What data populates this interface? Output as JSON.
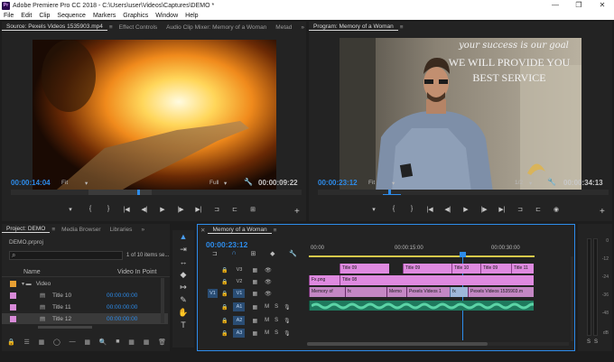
{
  "titlebar": {
    "logo": "Pr",
    "text": "Adobe Premiere Pro CC 2018 - C:\\Users\\user\\Videos\\Captures\\DEMO *",
    "minimize": "—",
    "restore": "❐",
    "close": "✕"
  },
  "menu": [
    "File",
    "Edit",
    "Clip",
    "Sequence",
    "Markers",
    "Graphics",
    "Window",
    "Help"
  ],
  "source": {
    "tabs": [
      "Source: Pexels Videos 1535903.mp4",
      "Effect Controls",
      "Audio Clip Mixer: Memory of a Woman",
      "Metad"
    ],
    "menu_icon": "≡",
    "more": "»",
    "timecode": "00:00:14:04",
    "fit": "Fit",
    "resolution": "Full",
    "duration": "00:00:09:22"
  },
  "program": {
    "tab": "Program: Memory of a Woman",
    "menu_icon": "≡",
    "timecode": "00:00:23:12",
    "fit": "Fit",
    "resolution": "1/2",
    "duration": "00:00:34:13",
    "overlay_line1": "your success is our goal",
    "overlay_line2": "WE WILL PROVIDE YOU",
    "overlay_line3": "BEST SERVICE"
  },
  "transport": [
    "▾",
    "{",
    "}",
    "|◀",
    "◀|",
    "▶",
    "|▶",
    "▶|",
    "⊐",
    "⊏",
    "⊞",
    "◉"
  ],
  "project": {
    "tabs": [
      "Project: DEMO",
      "Media Browser",
      "Libraries"
    ],
    "menu_icon": "≡",
    "more": "»",
    "file": "DEMO.prproj",
    "items_count": "1 of 10 items se...",
    "search_icon_glyph": "⌕",
    "col_name": "Name",
    "col_inpoint": "Video In Point",
    "rows": [
      {
        "name": "Video",
        "inpoint": "",
        "color": "#e8a033",
        "type": "folder",
        "icon": "▾ ▬"
      },
      {
        "name": "Title 10",
        "inpoint": "00:00:00:00",
        "color": "#d88ad8",
        "type": "title",
        "icon": "▤"
      },
      {
        "name": "Title 11",
        "inpoint": "00:00:00:00",
        "color": "#d88ad8",
        "type": "title",
        "icon": "▤"
      },
      {
        "name": "Title 12",
        "inpoint": "00:00:00:00",
        "color": "#d88ad8",
        "type": "title",
        "icon": "▤"
      }
    ],
    "bottom_icons": [
      "🔒",
      "☰",
      "▦",
      "◯",
      "—",
      "▦",
      "🔍",
      "■",
      "▦",
      "▦",
      "🗑"
    ]
  },
  "tools": [
    "▲",
    "⇥",
    "↔",
    "◆",
    "↦",
    "✎",
    "✋",
    "T"
  ],
  "timeline": {
    "close": "✕",
    "tab": "Memory of a Woman",
    "menu_icon": "≡",
    "timecode": "00:00:23:12",
    "ruler": [
      "00:00",
      "00:00:15:00",
      "00:00:30:00"
    ],
    "header_icons": [
      "⊐",
      "∩",
      "⊞",
      "◆",
      "🔧"
    ],
    "tracks": [
      {
        "src": "",
        "name": "V3",
        "lock": "🔒",
        "sync": "▦",
        "eye": "👁",
        "m": "",
        "s": "",
        "mic": ""
      },
      {
        "src": "",
        "name": "V2",
        "lock": "🔒",
        "sync": "▦",
        "eye": "👁",
        "m": "",
        "s": "",
        "mic": ""
      },
      {
        "src": "V1",
        "name": "V1",
        "lock": "🔒",
        "sync": "▦",
        "eye": "👁",
        "m": "",
        "s": "",
        "mic": ""
      },
      {
        "src": "",
        "name": "A1",
        "lock": "🔒",
        "sync": "▦",
        "eye": "",
        "m": "M",
        "s": "S",
        "mic": "🎙"
      },
      {
        "src": "",
        "name": "A2",
        "lock": "🔒",
        "sync": "▦",
        "eye": "",
        "m": "M",
        "s": "S",
        "mic": "🎙"
      },
      {
        "src": "",
        "name": "A3",
        "lock": "🔒",
        "sync": "▦",
        "eye": "",
        "m": "M",
        "s": "S",
        "mic": "🎙"
      }
    ],
    "clips_v3": [
      "Title 09",
      "Title 09",
      "Title 10",
      "Title 09",
      "Title 11"
    ],
    "clips_v2": [
      "Fx.png",
      "Title 08"
    ],
    "clips_v1": [
      "Memory of",
      "fx",
      "Memo",
      "Pexels Videos 1",
      "fx",
      "Pexels Videos 1535903.m"
    ]
  },
  "meter": {
    "labels": [
      "0",
      "-12",
      "-24",
      "-36",
      "-48",
      "dB"
    ],
    "solo": "S",
    "solo2": "S"
  }
}
